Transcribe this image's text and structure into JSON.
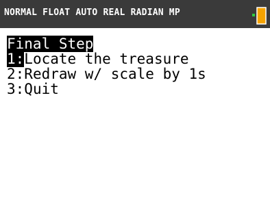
{
  "status_bar": {
    "text": "NORMAL FLOAT AUTO REAL RADIAN MP",
    "icon": "battery-icon",
    "colors": {
      "bar": "#3a3a3a",
      "battery": "#f5a300",
      "battery_tip": "#2ecc40"
    }
  },
  "menu": {
    "title": "Final Step",
    "items": [
      {
        "number": "1:",
        "label": "Locate the treasure",
        "selected": true
      },
      {
        "number": "2:",
        "label": "Redraw w/ scale by 1s",
        "selected": false
      },
      {
        "number": "3:",
        "label": "Quit",
        "selected": false
      }
    ]
  }
}
